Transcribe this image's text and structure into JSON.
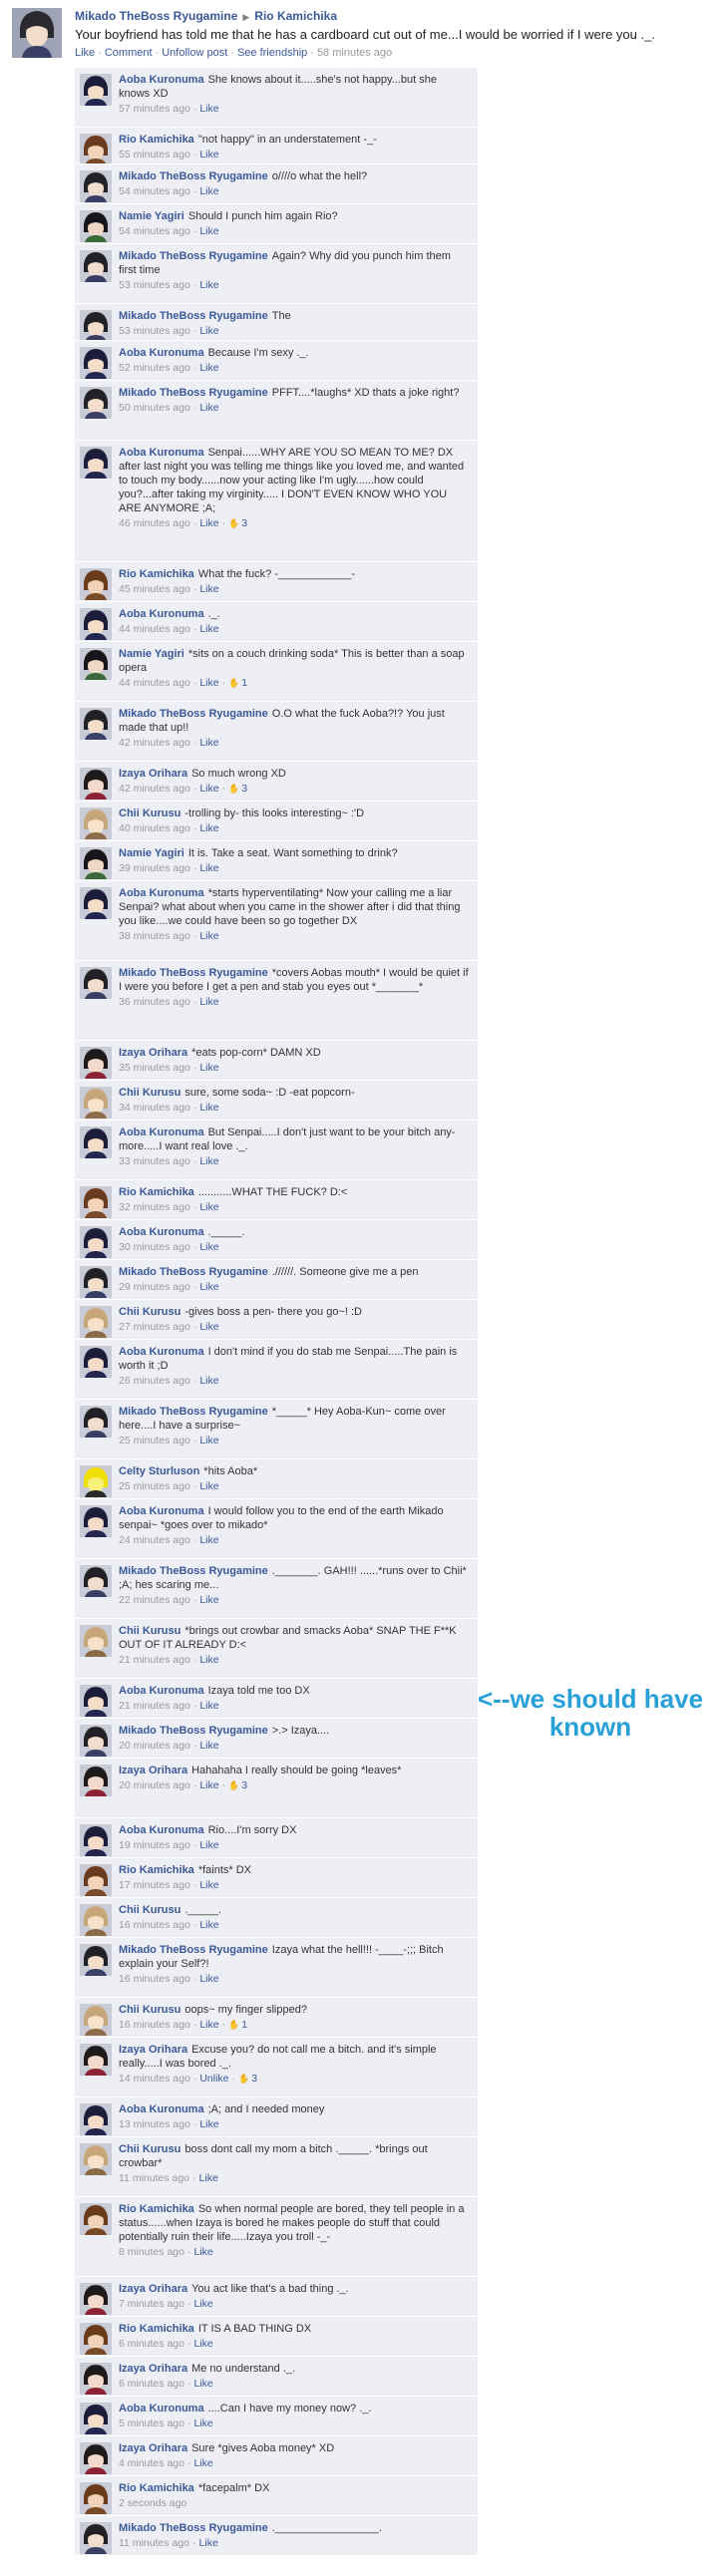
{
  "post": {
    "author": "Mikado TheBoss Ryugamine",
    "target": "Rio Kamichika",
    "body": "Your boyfriend has told me that he has a cardboard cut out of me...I would be worried if I were you ._.",
    "actions": [
      "Like",
      "Comment",
      "Unfollow post",
      "See friendship"
    ],
    "time": "58 minutes ago"
  },
  "comments": [
    {
      "name": "Aoba Kuronuma",
      "text": "She knows about it.....she's not happy...but she knows XD",
      "time": "57 minutes ago",
      "like": "Like",
      "likes": ""
    },
    {
      "name": "Rio Kamichika",
      "text": "\"not happy\" in an understatement -_-",
      "time": "55 minutes ago",
      "like": "Like",
      "likes": ""
    },
    {
      "name": "Mikado TheBoss Ryugamine",
      "text": "o////o what the hell?",
      "time": "54 minutes ago",
      "like": "Like",
      "likes": ""
    },
    {
      "name": "Namie Yagiri",
      "text": "Should I punch him again Rio?",
      "time": "54 minutes ago",
      "like": "Like",
      "likes": ""
    },
    {
      "name": "Mikado TheBoss Ryugamine",
      "text": "Again? Why did you punch him them first time",
      "time": "53 minutes ago",
      "like": "Like",
      "likes": ""
    },
    {
      "name": "Mikado TheBoss Ryugamine",
      "text": "The",
      "time": "53 minutes ago",
      "like": "Like",
      "likes": ""
    },
    {
      "name": "Aoba Kuronuma",
      "text": "Because I'm sexy ._.",
      "time": "52 minutes ago",
      "like": "Like",
      "likes": ""
    },
    {
      "name": "Mikado TheBoss Ryugamine",
      "text": "PFFT....*laughs* XD thats a joke right?",
      "time": "50 minutes ago",
      "like": "Like",
      "likes": ""
    },
    {
      "name": "Aoba Kuronuma",
      "text": "Senpai......WHY ARE YOU SO MEAN TO ME? DX after last night you was telling me things like you loved me, and wanted to touch my body......now your acting like I'm ugly......how could you?...after taking my virginity..... I DON'T EVEN KNOW WHO YOU ARE ANYMORE ;A;",
      "time": "46 minutes ago",
      "like": "Like",
      "likes": "3"
    },
    {
      "name": "Rio Kamichika",
      "text": "What the fuck? -____________-",
      "time": "45 minutes ago",
      "like": "Like",
      "likes": ""
    },
    {
      "name": "Aoba Kuronuma",
      "text": "._.",
      "time": "44 minutes ago",
      "like": "Like",
      "likes": ""
    },
    {
      "name": "Namie Yagiri",
      "text": "*sits on a couch drinking soda* This is better than a soap opera",
      "time": "44 minutes ago",
      "like": "Like",
      "likes": "1"
    },
    {
      "name": "Mikado TheBoss Ryugamine",
      "text": "O.O what the fuck Aoba?!? You just made that up!!",
      "time": "42 minutes ago",
      "like": "Like",
      "likes": ""
    },
    {
      "name": "Izaya Orihara",
      "text": "So much wrong XD",
      "time": "42 minutes ago",
      "like": "Like",
      "likes": "3"
    },
    {
      "name": "Chii Kurusu",
      "text": "-trolling by- this looks interesting~ :'D",
      "time": "40 minutes ago",
      "like": "Like",
      "likes": ""
    },
    {
      "name": "Namie Yagiri",
      "text": "It is. Take a seat. Want something to drink?",
      "time": "39 minutes ago",
      "like": "Like",
      "likes": ""
    },
    {
      "name": "Aoba Kuronuma",
      "text": "*starts hyperventilating* Now your calling me a liar Senpai? what about when you came in the shower after i did that thing you like....we could have been so go together DX",
      "time": "38 minutes ago",
      "like": "Like",
      "likes": ""
    },
    {
      "name": "Mikado TheBoss Ryugamine",
      "text": "*covers Aobas mouth* I would be quiet if I were you before I get a pen and stab you eyes out *_______*",
      "time": "36 minutes ago",
      "like": "Like",
      "likes": ""
    },
    {
      "name": "Izaya Orihara",
      "text": "*eats pop-corn* DAMN XD",
      "time": "35 minutes ago",
      "like": "Like",
      "likes": ""
    },
    {
      "name": "Chii Kurusu",
      "text": "sure, some soda~ :D -eat popcorn-",
      "time": "34 minutes ago",
      "like": "Like",
      "likes": ""
    },
    {
      "name": "Aoba Kuronuma",
      "text": "But Senpai.....I don't just want to be your bitch any-more.....I want real love ._.",
      "time": "33 minutes ago",
      "like": "Like",
      "likes": ""
    },
    {
      "name": "Rio Kamichika",
      "text": "...........WHAT THE FUCK? D:<",
      "time": "32 minutes ago",
      "like": "Like",
      "likes": ""
    },
    {
      "name": "Aoba Kuronuma",
      "text": "._____.",
      "time": "30 minutes ago",
      "like": "Like",
      "likes": ""
    },
    {
      "name": "Mikado TheBoss Ryugamine",
      "text": ".//////. Someone give me a pen",
      "time": "29 minutes ago",
      "like": "Like",
      "likes": ""
    },
    {
      "name": "Chii Kurusu",
      "text": "-gives boss a pen- there you go~! :D",
      "time": "27 minutes ago",
      "like": "Like",
      "likes": ""
    },
    {
      "name": "Aoba Kuronuma",
      "text": "I don't mind if you do stab me Senpai.....The pain is worth it ;D",
      "time": "26 minutes ago",
      "like": "Like",
      "likes": ""
    },
    {
      "name": "Mikado TheBoss Ryugamine",
      "text": "*_____* Hey Aoba-Kun~ come over here....I have a surprise~",
      "time": "25 minutes ago",
      "like": "Like",
      "likes": ""
    },
    {
      "name": "Celty Sturluson",
      "text": "*hits Aoba*",
      "time": "25 minutes ago",
      "like": "Like",
      "likes": ""
    },
    {
      "name": "Aoba Kuronuma",
      "text": "I would follow you to the end of the earth Mikado senpai~ *goes over to mikado*",
      "time": "24 minutes ago",
      "like": "Like",
      "likes": ""
    },
    {
      "name": "Mikado TheBoss Ryugamine",
      "text": "._______. GAH!!! ......*runs over to Chii* ;A; hes scaring me...",
      "time": "22 minutes ago",
      "like": "Like",
      "likes": ""
    },
    {
      "name": "Chii Kurusu",
      "text": "*brings out crowbar and smacks Aoba* SNAP THE F**K OUT OF IT ALREADY D:<",
      "time": "21 minutes ago",
      "like": "Like",
      "likes": ""
    },
    {
      "name": "Aoba Kuronuma",
      "text": "Izaya told me too DX",
      "time": "21 minutes ago",
      "like": "Like",
      "likes": ""
    },
    {
      "name": "Mikado TheBoss Ryugamine",
      "text": ">.> Izaya....",
      "time": "20 minutes ago",
      "like": "Like",
      "likes": ""
    },
    {
      "name": "Izaya Orihara",
      "text": "Hahahaha I really should be going *leaves*",
      "time": "20 minutes ago",
      "like": "Like",
      "likes": "3"
    },
    {
      "name": "Aoba Kuronuma",
      "text": "Rio....I'm sorry DX",
      "time": "19 minutes ago",
      "like": "Like",
      "likes": ""
    },
    {
      "name": "Rio Kamichika",
      "text": "*faints* DX",
      "time": "17 minutes ago",
      "like": "Like",
      "likes": ""
    },
    {
      "name": "Chii Kurusu",
      "text": "._____.",
      "time": "16 minutes ago",
      "like": "Like",
      "likes": ""
    },
    {
      "name": "Mikado TheBoss Ryugamine",
      "text": "Izaya what the hell!!! -____-;;; Bitch explain your Self?!",
      "time": "16 minutes ago",
      "like": "Like",
      "likes": ""
    },
    {
      "name": "Chii Kurusu",
      "text": "oops~ my finger slipped?",
      "time": "16 minutes ago",
      "like": "Like",
      "likes": "1"
    },
    {
      "name": "Izaya Orihara",
      "text": "Excuse you? do not call me a bitch. and it's simple really.....I was bored ._.",
      "time": "14 minutes ago",
      "like": "Unlike",
      "likes": "3"
    },
    {
      "name": "Aoba Kuronuma",
      "text": ";A; and I needed money",
      "time": "13 minutes ago",
      "like": "Like",
      "likes": ""
    },
    {
      "name": "Chii Kurusu",
      "text": "boss dont call my mom a bitch ._____. *brings out crowbar*",
      "time": "11 minutes ago",
      "like": "Like",
      "likes": ""
    },
    {
      "name": "Rio Kamichika",
      "text": "So when normal people are bored, they tell people in a status......when Izaya is bored he makes people do stuff that could potentially ruin their life.....Izaya you troll -_-",
      "time": "8 minutes ago",
      "like": "Like",
      "likes": ""
    },
    {
      "name": "Izaya Orihara",
      "text": "You act like that's a bad thing ._.",
      "time": "7 minutes ago",
      "like": "Like",
      "likes": ""
    },
    {
      "name": "Rio Kamichika",
      "text": "IT IS A BAD THING DX",
      "time": "6 minutes ago",
      "like": "Like",
      "likes": ""
    },
    {
      "name": "Izaya Orihara",
      "text": "Me no understand ._.",
      "time": "6 minutes ago",
      "like": "Like",
      "likes": ""
    },
    {
      "name": "Aoba Kuronuma",
      "text": "....Can I have my money now? ._.",
      "time": "5 minutes ago",
      "like": "Like",
      "likes": ""
    },
    {
      "name": "Izaya Orihara",
      "text": "Sure *gives Aoba money* XD",
      "time": "4 minutes ago",
      "like": "Like",
      "likes": ""
    },
    {
      "name": "Rio Kamichika",
      "text": "*facepalm* DX",
      "time": "2 seconds ago",
      "like": "",
      "likes": ""
    },
    {
      "name": "Mikado TheBoss Ryugamine",
      "text": "._________________.",
      "time": "11 minutes ago",
      "like": "Like",
      "likes": ""
    }
  ],
  "annotation": {
    "line1": "<--we should have",
    "line2": "known"
  },
  "colors": {
    "link": "#3b5998",
    "comment_bg": "#edeff4",
    "annotation": "#29a0d8"
  }
}
